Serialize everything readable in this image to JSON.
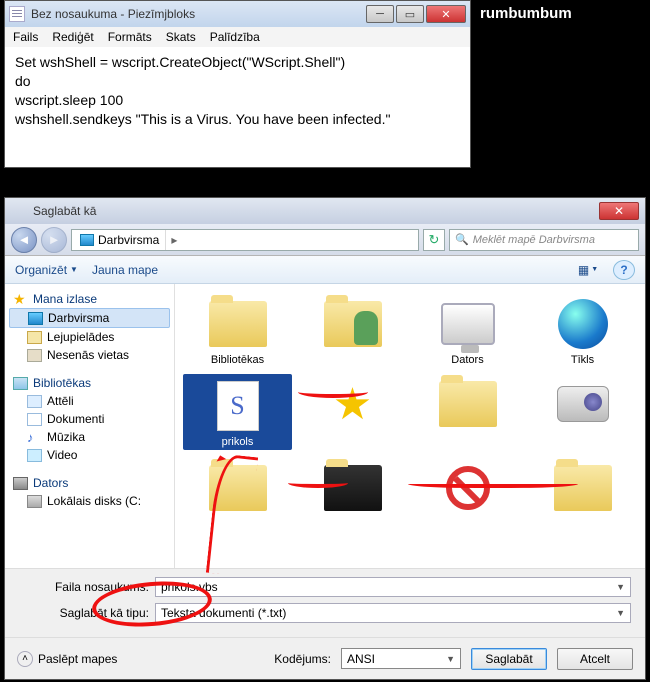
{
  "desktop": {
    "label": "rumbumbum"
  },
  "notepad": {
    "title": "Bez nosaukuma - Piezīmjbloks",
    "menu": {
      "file": "Fails",
      "edit": "Rediģēt",
      "format": "Formāts",
      "view": "Skats",
      "help": "Palīdzība"
    },
    "lines": {
      "l1": "Set wshShell = wscript.CreateObject(\"WScript.Shell\")",
      "l2": "do",
      "l3": "wscript.sleep 100",
      "l4": "wshshell.sendkeys \"This is a Virus. You have been infected.\""
    }
  },
  "save": {
    "title": "Saglabāt kā",
    "breadcrumb": "Darbvirsma",
    "search_placeholder": "Meklēt mapē Darbvirsma",
    "toolbar": {
      "organize": "Organizēt",
      "newfolder": "Jauna mape"
    },
    "tree": {
      "fav": "Mana izlase",
      "desktop": "Darbvirsma",
      "downloads": "Lejupielādes",
      "recent": "Nesenās vietas",
      "libs": "Bibliotēkas",
      "pics": "Attēli",
      "docs": "Dokumenti",
      "music": "Mūzika",
      "video": "Video",
      "computer": "Dators",
      "drive": "Lokālais disks (C:"
    },
    "files": {
      "libs": "Bibliotēkas",
      "user": "",
      "computer": "Dators",
      "network": "Tīkls",
      "prikols": "prikols"
    },
    "labels": {
      "filename": "Faila nosaukums:",
      "filetype": "Saglabāt kā tipu:"
    },
    "values": {
      "filename": "prikols.vbs",
      "filetype": "Teksta dokumenti (*.txt)"
    },
    "footer": {
      "hide": "Paslēpt mapes",
      "encoding_label": "Kodējums:",
      "encoding_value": "ANSI",
      "save": "Saglabāt",
      "cancel": "Atcelt"
    }
  }
}
